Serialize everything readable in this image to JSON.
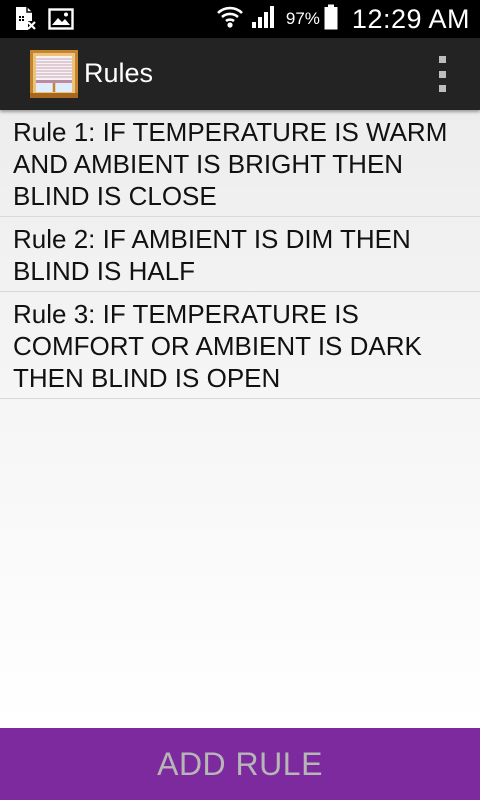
{
  "status_bar": {
    "battery_percent": "97%",
    "time": "12:29 AM"
  },
  "action_bar": {
    "title": "Rules"
  },
  "rules": [
    "Rule 1: IF TEMPERATURE IS WARM AND AMBIENT IS BRIGHT THEN BLIND IS CLOSE",
    "Rule 2: IF AMBIENT IS DIM THEN BLIND IS HALF",
    "Rule 3: IF TEMPERATURE IS COMFORT OR AMBIENT IS DARK THEN BLIND IS OPEN"
  ],
  "add_button_label": "ADD RULE",
  "colors": {
    "status_bar": "#000000",
    "action_bar": "#232323",
    "add_button": "#7d2a9e",
    "add_button_text": "#b6b6b6"
  },
  "icons": {
    "status_left": [
      "document-blocked-icon",
      "image-icon"
    ],
    "status_right": [
      "wifi-icon",
      "signal-icon",
      "battery-icon"
    ],
    "app_logo": "window-blind-icon",
    "menu": "overflow-menu-icon"
  }
}
